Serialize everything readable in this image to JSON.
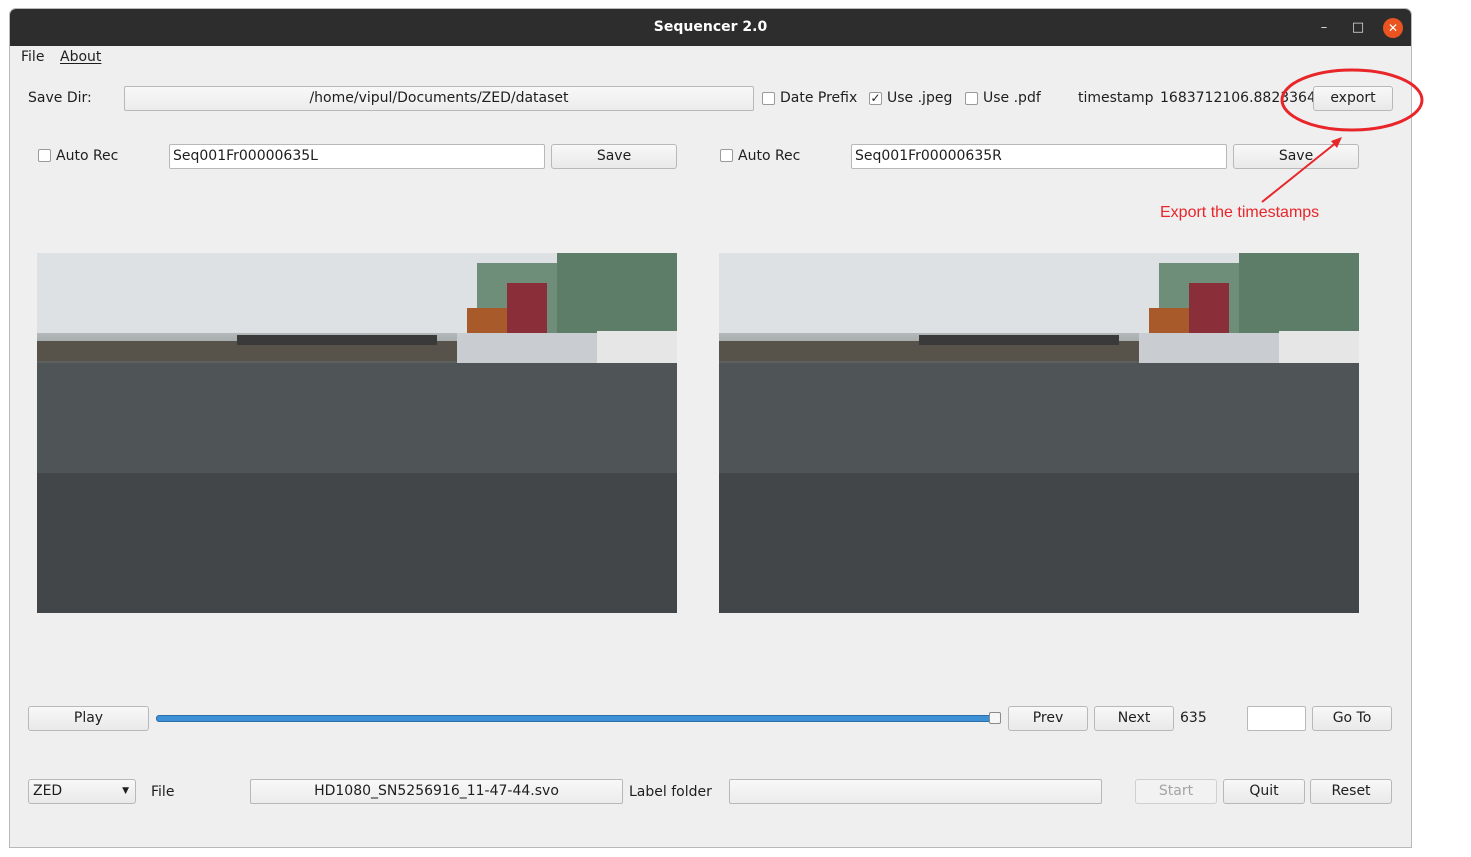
{
  "window": {
    "title": "Sequencer 2.0",
    "minimize_glyph": "–",
    "maximize_glyph": "□",
    "close_glyph": "✕"
  },
  "menu": {
    "file": "File",
    "about": "About"
  },
  "save_dir": {
    "label": "Save Dir:",
    "path": "/home/vipul/Documents/ZED/dataset"
  },
  "options": {
    "date_prefix": {
      "label": "Date Prefix",
      "checked": false
    },
    "use_jpeg": {
      "label": "Use .jpeg",
      "checked": true,
      "mark": "✓"
    },
    "use_pdf": {
      "label": "Use .pdf",
      "checked": false
    }
  },
  "timestamp": {
    "label": "timestamp",
    "value": "1683712106.8823364",
    "export_label": "export"
  },
  "left_panel": {
    "auto_rec_label": "Auto Rec",
    "auto_rec_checked": false,
    "filename": "Seq001Fr00000635L",
    "save_label": "Save",
    "image_icon": "harbor-image"
  },
  "right_panel": {
    "auto_rec_label": "Auto Rec",
    "auto_rec_checked": false,
    "filename": "Seq001Fr00000635R",
    "save_label": "Save",
    "image_icon": "harbor-image"
  },
  "playback": {
    "play_label": "Play",
    "progress_fraction": 1.0,
    "prev_label": "Prev",
    "next_label": "Next",
    "frame": "635",
    "goto_value": "",
    "goto_label": "Go To"
  },
  "bottom": {
    "source": "ZED",
    "file_label": "File",
    "file_name": "HD1080_SN5256916_11-47-44.svo",
    "label_folder_label": "Label folder",
    "label_folder_value": "",
    "start_label": "Start",
    "quit_label": "Quit",
    "reset_label": "Reset"
  },
  "annotation": {
    "text": "Export the timestamps",
    "color": "#e8262a"
  }
}
